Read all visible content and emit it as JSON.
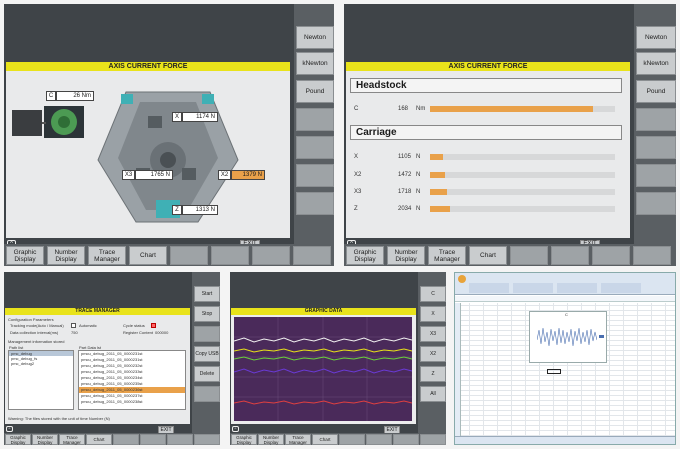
{
  "panel1": {
    "title": "AXIS CURRENT FORCE",
    "side_buttons": [
      "Newton",
      "kNewton",
      "Pound"
    ],
    "bottom_buttons": [
      "Graphic\nDisplay",
      "Number\nDisplay",
      "Trace\nManager",
      "Chart"
    ],
    "exit": "EXIT",
    "axes": {
      "c": {
        "key": "C",
        "value": "26 Nm"
      },
      "x": {
        "key": "X",
        "value": "1174 N"
      },
      "x3": {
        "key": "X3",
        "value": "1765 N"
      },
      "x2": {
        "key": "X2",
        "value": "1379 N"
      },
      "z": {
        "key": "Z",
        "value": "1313 N"
      }
    }
  },
  "panel2": {
    "title": "AXIS CURRENT FORCE",
    "side_buttons": [
      "Newton",
      "kNewton",
      "Pound"
    ],
    "bottom_buttons": [
      "Graphic\nDisplay",
      "Number\nDisplay",
      "Trace\nManager",
      "Chart"
    ],
    "exit": "EXIT",
    "headstock": {
      "title": "Headstock",
      "rows": [
        {
          "axis": "C",
          "value": "168",
          "unit": "Nm",
          "level": 0.88
        }
      ]
    },
    "carriage": {
      "title": "Carriage",
      "rows": [
        {
          "axis": "X",
          "value": "1105",
          "unit": "N",
          "level": 0.07
        },
        {
          "axis": "X2",
          "value": "1472",
          "unit": "N",
          "level": 0.08
        },
        {
          "axis": "X3",
          "value": "1718",
          "unit": "N",
          "level": 0.09
        },
        {
          "axis": "Z",
          "value": "2034",
          "unit": "N",
          "level": 0.11
        }
      ]
    }
  },
  "panel3": {
    "title": "TRACE MANAGER",
    "side_buttons": [
      "Start",
      "Stop",
      "Copy USB",
      "Delete"
    ],
    "bottom_buttons": [
      "Graphic\nDisplay",
      "Number\nDisplay",
      "Trace\nManager",
      "Chart"
    ],
    "exit": "EXIT",
    "config_title": "Configuration Parameters",
    "tracking_mode": "Tracking mode(Auto / Manual)",
    "automatic": "Automatic",
    "cycle_status": "Cycle status",
    "interval": "Data collection interval(ms)",
    "interval_value": "750",
    "register_content": "Register Content",
    "register_value": "000000",
    "mgmt_title": "Management information stored",
    "path_header": "Path list",
    "path_items": [
      "pmc_debug",
      "pmc_debug_fs",
      "pmc_debug2"
    ],
    "data_header": "Part Data lst",
    "data_items": [
      "pmcu_debug_2011_05_0000231st",
      "pmcu_debug_2011_05_0000231st",
      "pmcu_debug_2011_05_0000232st",
      "pmcu_debug_2011_05_0000233st",
      "pmcu_debug_2011_05_0000234st",
      "pmcu_debug_2011_05_0000235st",
      "pmcu_debug_2011_05_0000236st",
      "pmcu_debug_2011_05_0000237st",
      "pmcu_debug_2011_05_0000238st"
    ],
    "selected_index": 6,
    "status": "Warning: The files stored with the unit of time Number (N)"
  },
  "panel4": {
    "title": "GRAPHIC DATA",
    "side_buttons": [
      "C",
      "X",
      "X3",
      "X2",
      "Z",
      "All"
    ],
    "bottom_buttons": [
      "Graphic\nDisplay",
      "Number\nDisplay",
      "Trace\nManager",
      "Chart"
    ],
    "exit": "EXIT",
    "colors": {
      "white": "#f2f2f2",
      "yellow": "#e8e21a",
      "green": "#6ad13c",
      "purple": "#6a3ad6",
      "red": "#e04040"
    }
  },
  "panel5": {
    "chart_title": "C"
  }
}
